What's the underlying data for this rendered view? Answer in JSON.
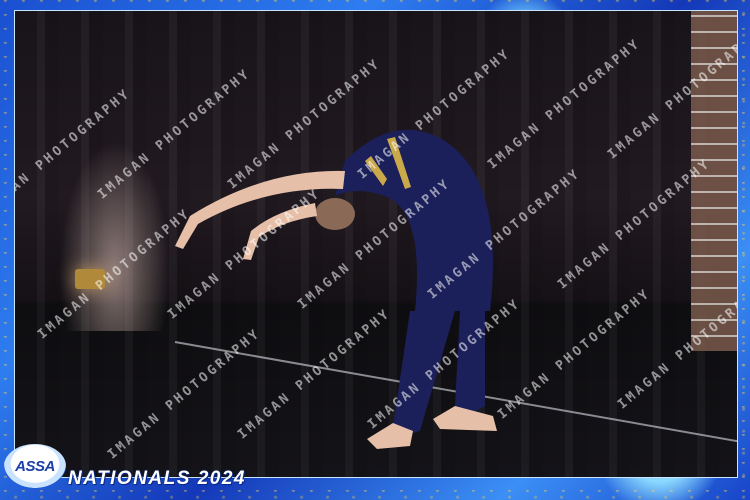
{
  "photo": {
    "subject": "dancer-backbend"
  },
  "watermark": {
    "text": "IMAGAN PHOTOGRAPHY"
  },
  "logo": {
    "text": "ASSA"
  },
  "event": {
    "title": "NATIONALS 2024"
  },
  "colors": {
    "frame_blue": "#2e7df0",
    "costume_navy": "#1b1f5a",
    "costume_gold": "#c9a94a"
  }
}
